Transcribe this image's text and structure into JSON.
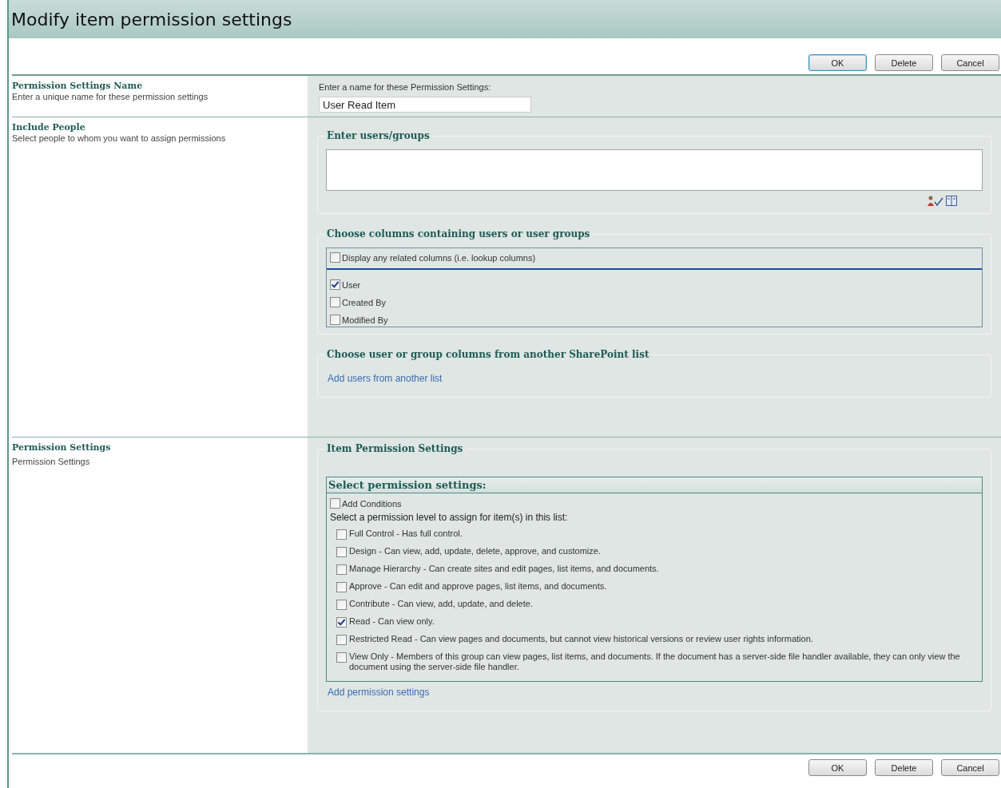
{
  "title": "Modify item permission settings",
  "top_buttons": [
    {
      "label": "OK",
      "focused": true
    },
    {
      "label": "Delete",
      "focused": false
    },
    {
      "label": "Cancel",
      "focused": false
    }
  ],
  "name_section": {
    "title": "Permission Settings Name",
    "description": "Enter a unique name for these permission settings",
    "field_label": "Enter a name for these Permission Settings:",
    "field_value": "User Read Item"
  },
  "people_section": {
    "title": "Include People",
    "description": "Select people to whom you want to assign permissions",
    "users_group": {
      "legend": "Enter users/groups"
    },
    "columns_group": {
      "legend": "Choose columns containing users or user groups",
      "related": {
        "label": "Display any related columns (i.e. lookup columns)",
        "checked": false
      },
      "columns": [
        {
          "label": "User",
          "checked": true
        },
        {
          "label": "Created By",
          "checked": false
        },
        {
          "label": "Modified By",
          "checked": false
        }
      ]
    },
    "other_list_group": {
      "legend": "Choose user or group columns from another SharePoint list",
      "link": "Add users from another list"
    }
  },
  "permission_section": {
    "title": "Permission Settings",
    "description": "Permission Settings",
    "legend": "Item Permission Settings",
    "box_title": "Select permission settings:",
    "conditions": {
      "label": "Add Conditions",
      "checked": false
    },
    "prompt": "Select a permission level to assign for item(s) in this list:",
    "levels": [
      {
        "label": "Full Control - Has full control.",
        "checked": false
      },
      {
        "label": "Design - Can view, add, update, delete, approve, and customize.",
        "checked": false
      },
      {
        "label": "Manage Hierarchy - Can create sites and edit pages, list items, and documents.",
        "checked": false
      },
      {
        "label": "Approve - Can edit and approve pages, list items, and documents.",
        "checked": false
      },
      {
        "label": "Contribute - Can view, add, update, and delete.",
        "checked": false
      },
      {
        "label": "Read - Can view only.",
        "checked": true
      },
      {
        "label": "Restricted Read - Can view pages and documents, but cannot view historical versions or review user rights information.",
        "checked": false
      },
      {
        "label": "View Only - Members of this group can view pages, list items, and documents. If the document has a server-side file handler available, they can only view the document using the server-side file handler.",
        "checked": false
      }
    ],
    "link": "Add permission settings"
  },
  "bottom_buttons": [
    {
      "label": "OK",
      "focused": false
    },
    {
      "label": "Delete",
      "focused": false
    },
    {
      "label": "Cancel",
      "focused": false
    }
  ]
}
